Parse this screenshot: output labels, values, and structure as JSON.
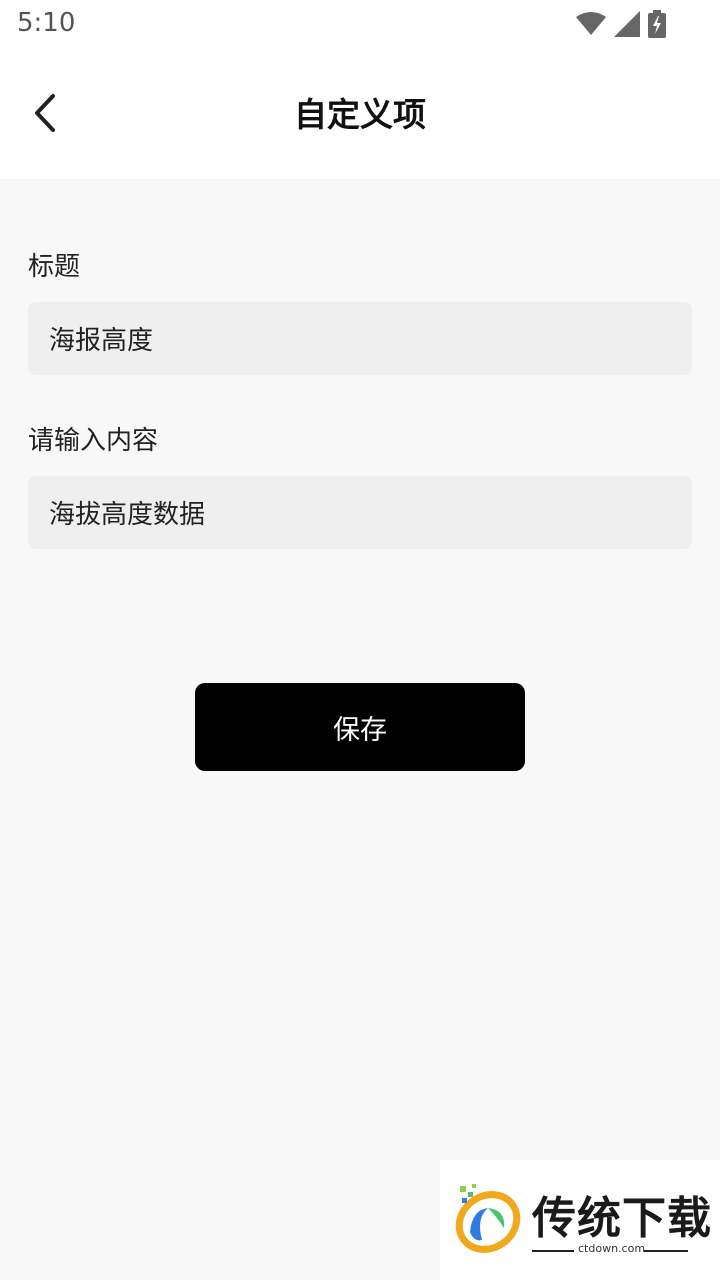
{
  "status_bar": {
    "time": "5:10",
    "icons": [
      "wifi-icon",
      "signal-icon",
      "battery-charging-icon"
    ]
  },
  "header": {
    "title": "自定义项",
    "back_icon": "chevron-left-icon"
  },
  "form": {
    "title_label": "标题",
    "title_value": "海报高度",
    "content_label": "请输入内容",
    "content_value": "海拔高度数据"
  },
  "actions": {
    "save_label": "保存"
  },
  "watermark": {
    "name": "传统下载",
    "url": "ctdown.com"
  },
  "colors": {
    "page_background": "#f8f8f8",
    "input_background": "#efefef",
    "button_background": "#000000",
    "button_text": "#ffffff"
  }
}
